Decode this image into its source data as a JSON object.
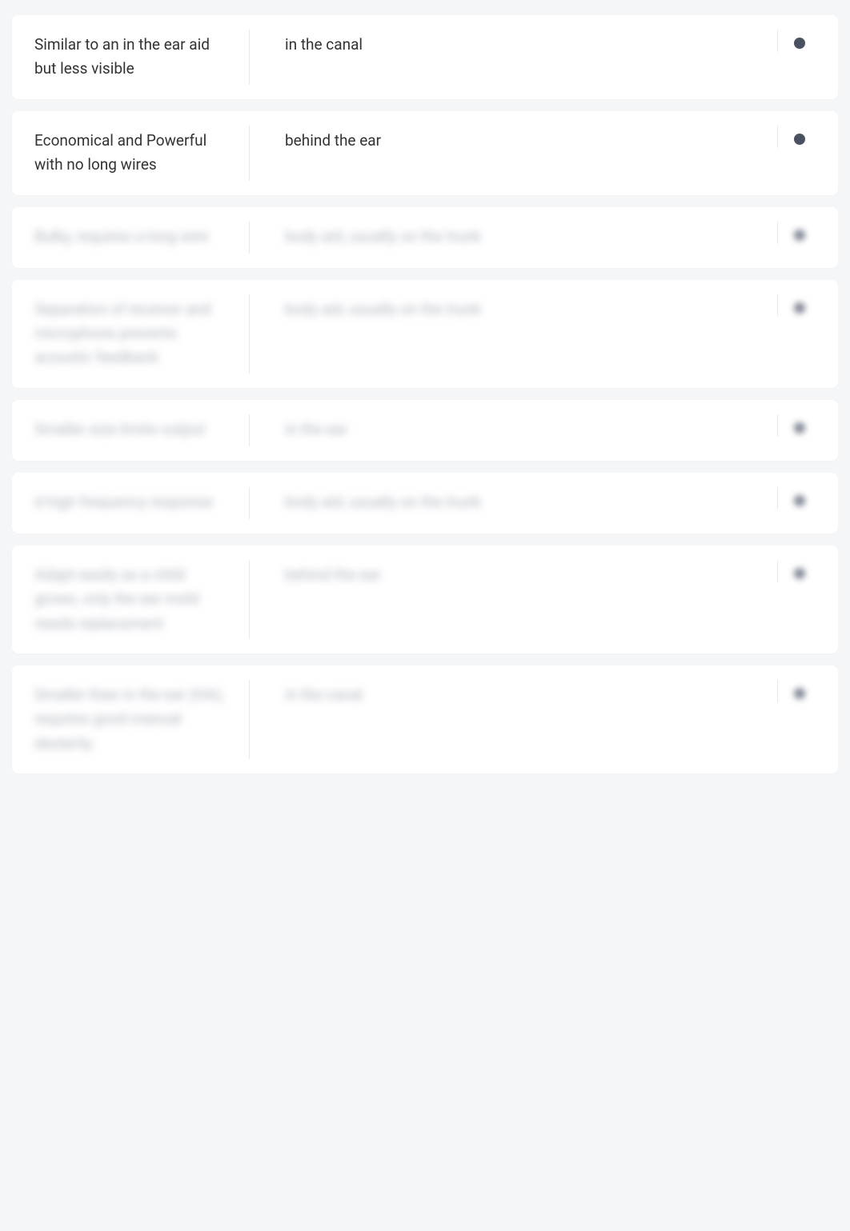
{
  "rows": [
    {
      "description": "Similar to an in the ear aid but less visible",
      "type": "in the canal",
      "blurred": false
    },
    {
      "description": "Economical and Powerful with no long wires",
      "type": "behind the ear",
      "blurred": false
    },
    {
      "description": "Bulky, requires a long wire",
      "type": "body aid, usually on the trunk",
      "blurred": true
    },
    {
      "description": "Separation of receiver and microphone prevents acoustic feedback",
      "type": "body aid, usually on the trunk",
      "blurred": true
    },
    {
      "description": "Smaller size limits output",
      "type": "in the ear",
      "blurred": true
    },
    {
      "description": "d high frequency response",
      "type": "body aid, usually on the trunk",
      "blurred": true
    },
    {
      "description": "Adapt easily as a child grows, only the ear mold needs replacement",
      "type": "behind the ear",
      "blurred": true
    },
    {
      "description": "Smaller than in the ear (HA), requires good manual dexterity",
      "type": "in the canal",
      "blurred": true
    }
  ]
}
